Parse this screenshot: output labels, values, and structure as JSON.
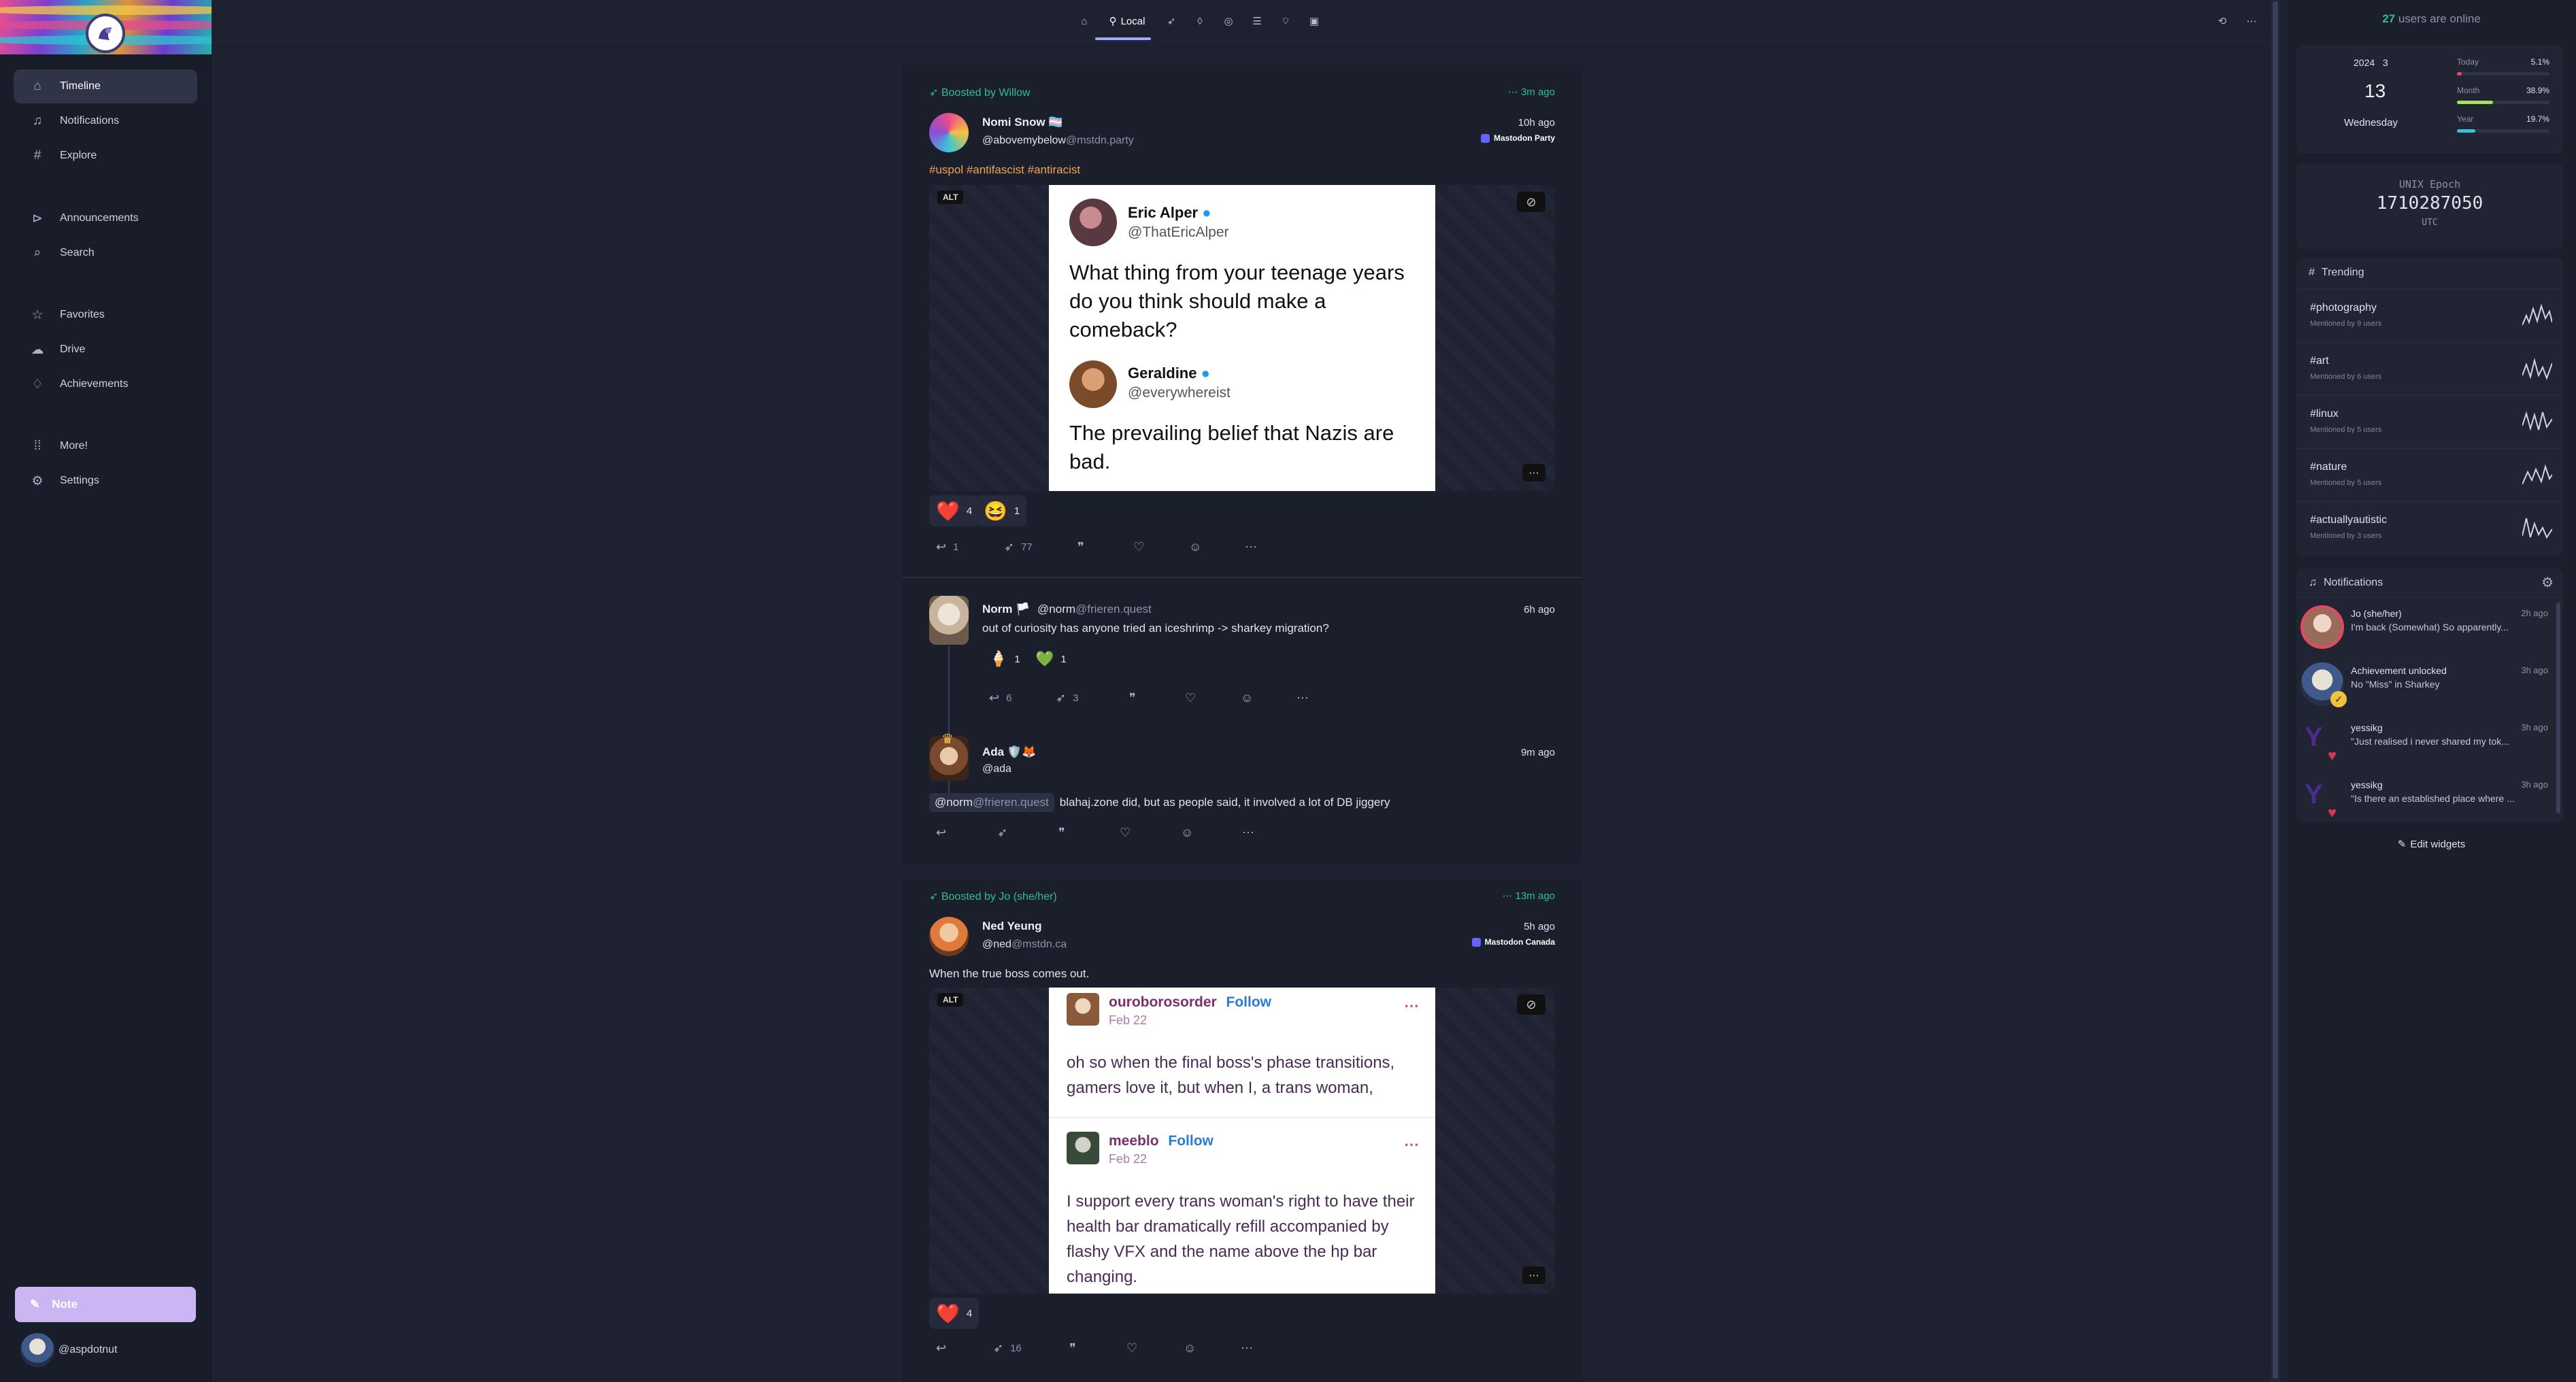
{
  "sidebar": {
    "items": [
      {
        "label": "Timeline",
        "icon": "house-icon"
      },
      {
        "label": "Notifications",
        "icon": "bell-icon"
      },
      {
        "label": "Explore",
        "icon": "hash-icon"
      },
      {
        "label": "Announcements",
        "icon": "megaphone-icon"
      },
      {
        "label": "Search",
        "icon": "search-icon"
      },
      {
        "label": "Favorites",
        "icon": "star-icon"
      },
      {
        "label": "Drive",
        "icon": "cloud-icon"
      },
      {
        "label": "Achievements",
        "icon": "medal-icon"
      },
      {
        "label": "More!",
        "icon": "grid-icon"
      },
      {
        "label": "Settings",
        "icon": "gear-icon"
      }
    ],
    "note_label": "Note",
    "account_handle": "@aspdotnut"
  },
  "topbar": {
    "active_tab_label": "Local",
    "tab_icons": [
      "home-icon",
      "local-icon",
      "rocket-icon",
      "droplet-icon",
      "globe-icon",
      "list-icon",
      "antenna-icon",
      "channel-icon"
    ],
    "right_icons": [
      "refresh-icon",
      "ellipsis-icon"
    ]
  },
  "feed": {
    "post1": {
      "boost_prefix": "Boosted by",
      "boosted_by": "Willow",
      "boost_time": "3m ago",
      "author": "Nomi Snow 🏳️‍⚧️",
      "handle_user": "@abovemybelow",
      "handle_host": "@mstdn.party",
      "time": "10h ago",
      "instance": "Mastodon Party",
      "hashtags": "#uspol #antifascist #antiracist",
      "alt": "ALT",
      "image": {
        "name1": "Eric Alper",
        "handle1": "@ThatEricAlper",
        "text1": "What thing from your teenage years do you think should make a comeback?",
        "name2": "Geraldine",
        "handle2": "@everywhereist",
        "text2": "The prevailing belief that Nazis are bad."
      },
      "reactions": [
        {
          "emoji": "❤️",
          "count": "4"
        },
        {
          "emoji": "😆",
          "count": "1"
        }
      ],
      "reply_count": "1",
      "renote_count": "77"
    },
    "post2": {
      "author": "Norm 🏳️",
      "handle_user": "@norm",
      "handle_host": "@frieren.quest",
      "time": "6h ago",
      "text": "out of curiosity has anyone tried an iceshrimp -> sharkey migration?",
      "reactions": [
        {
          "emoji": "🍦",
          "count": "1"
        },
        {
          "emoji": "💚",
          "count": "1"
        }
      ],
      "reply_count": "6",
      "renote_count": "3"
    },
    "post3": {
      "author": "Ada 🛡️🦊",
      "handle": "@ada",
      "time": "9m ago",
      "mention_user": "@norm",
      "mention_host": "@frieren.quest",
      "text": "blahaj.zone did, but as people said, it involved a lot of DB jiggery"
    },
    "post4": {
      "boost_prefix": "Boosted by",
      "boosted_by": "Jo (she/her)",
      "boost_time": "13m ago",
      "author": "Ned Yeung",
      "handle_user": "@ned",
      "handle_host": "@mstdn.ca",
      "time": "5h ago",
      "instance": "Mastodon Canada",
      "text": "When the true boss comes out.",
      "alt": "ALT",
      "image": {
        "user1": "ouroborosorder",
        "follow": "Follow",
        "date1": "Feb 22",
        "text1": "oh so when the final boss's phase transitions, gamers love it, but when I, a trans woman,",
        "user2": "meeblo",
        "date2": "Feb 22",
        "text2": "I support every trans woman's right to have their health bar dramatically refill accompanied by flashy VFX and the name above the hp bar changing."
      },
      "reactions": [
        {
          "emoji": "❤️",
          "count": "4"
        }
      ],
      "renote_count": "16"
    }
  },
  "right": {
    "online_count": "27",
    "online_text": "users are online",
    "calendar": {
      "year": "2024",
      "month": "3",
      "day": "13",
      "weekday": "Wednesday",
      "today_label": "Today",
      "today_pct": "5.1%",
      "today_value": 0.051,
      "month_label": "Month",
      "month_pct": "38.9%",
      "month_value": 0.389,
      "year_label": "Year",
      "year_pct": "19.7%",
      "year_value": 0.197
    },
    "clock": {
      "label": "UNIX Epoch",
      "value": "1710287050",
      "tz": "UTC"
    },
    "trending": {
      "title": "Trending",
      "items": [
        {
          "tag": "#photography",
          "sub": "Mentioned by 9 users"
        },
        {
          "tag": "#art",
          "sub": "Mentioned by 6 users"
        },
        {
          "tag": "#linux",
          "sub": "Mentioned by 5 users"
        },
        {
          "tag": "#nature",
          "sub": "Mentioned by 5 users"
        },
        {
          "tag": "#actuallyautistic",
          "sub": "Mentioned by 3 users"
        }
      ]
    },
    "notifications": {
      "title": "Notifications",
      "items": [
        {
          "title": "Jo (she/her)",
          "text": "I'm back (Somewhat)  So apparently...",
          "time": "2h ago"
        },
        {
          "title": "Achievement unlocked",
          "text": "No \"Miss\" in Sharkey",
          "time": "3h ago"
        },
        {
          "title": "yessikg",
          "text": "\"Just realised i never shared my tok...",
          "time": "3h ago"
        },
        {
          "title": "yessikg",
          "text": "\"Is there an established place where ...",
          "time": "3h ago"
        }
      ]
    },
    "edit_widgets": "Edit widgets"
  }
}
